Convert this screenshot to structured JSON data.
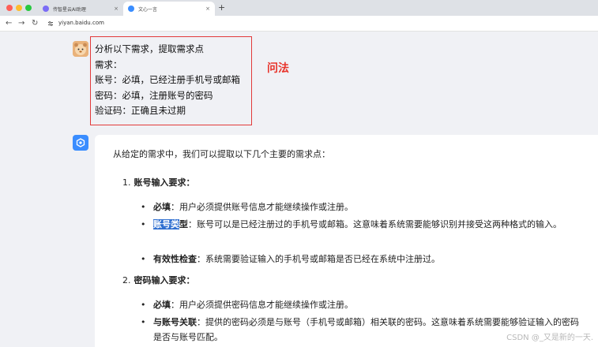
{
  "browser": {
    "tabs": [
      {
        "title": "传智星云AI助理",
        "active": false
      },
      {
        "title": "文心一言",
        "active": true
      }
    ],
    "new_tab_symbol": "+",
    "close_symbol": "×",
    "url": "yiyan.baidu.com",
    "nav": {
      "back": "←",
      "forward": "→",
      "reload": "↻"
    },
    "colors": {
      "close": "#ff5f57",
      "minimize": "#febc2e",
      "maximize": "#28c840"
    }
  },
  "question": {
    "lines": [
      "分析以下需求，提取需求点",
      "需求：",
      "账号：必填，已经注册手机号或邮箱",
      "密码：必填，注册账号的密码",
      "验证码：正确且未过期"
    ],
    "annotation": "问法"
  },
  "answer": {
    "intro": "从给定的需求中，我们可以提取以下几个主要的需求点：",
    "sections": [
      {
        "number": "1.",
        "heading": "账号输入要求：",
        "bullets": [
          {
            "label": "必填",
            "text": "：用户必须提供账号信息才能继续操作或注册。"
          },
          {
            "label_highlight": "账号类",
            "label_rest": "型",
            "text": "：账号可以是已经注册过的手机号或邮箱。这意味着系统需要能够识别并接受这两种格式的输入。"
          },
          {
            "label": "有效性检查",
            "text": "：系统需要验证输入的手机号或邮箱是否已经在系统中注册过。"
          }
        ]
      },
      {
        "number": "2.",
        "heading": "密码输入要求：",
        "bullets": [
          {
            "label": "必填",
            "text": "：用户必须提供密码信息才能继续操作或注册。"
          },
          {
            "label": "与账号关联",
            "text": "：提供的密码必须是与账号（手机号或邮箱）相关联的密码。这意味着系统需要能够验证输入的密码是否与账号匹配。"
          }
        ]
      }
    ],
    "bullet_symbol": "•"
  },
  "watermark": "CSDN @_又是新的一天."
}
